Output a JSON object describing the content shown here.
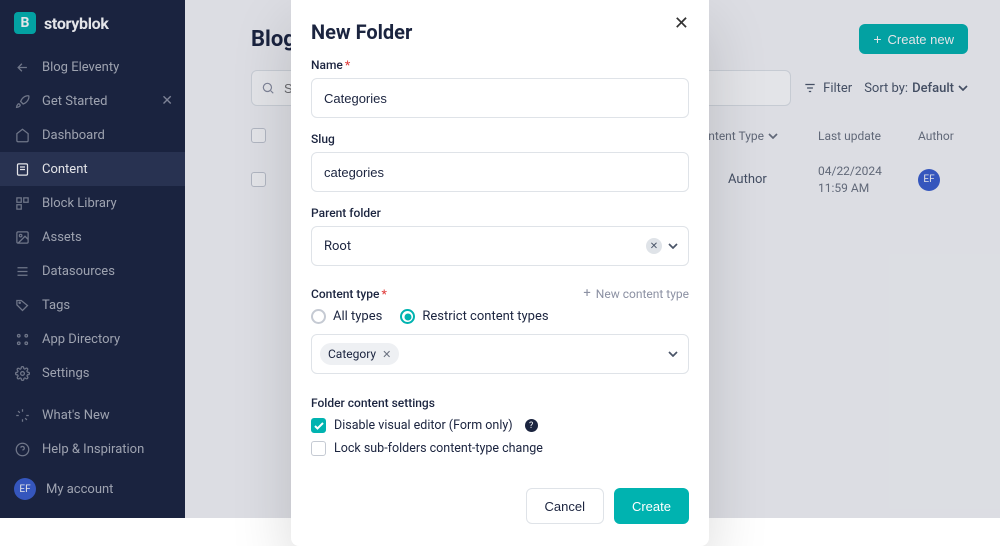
{
  "brand": "storyblok",
  "sidebar": {
    "space_name": "Blog Eleventy",
    "get_started": "Get Started",
    "items": [
      {
        "label": "Dashboard"
      },
      {
        "label": "Content"
      },
      {
        "label": "Block Library"
      },
      {
        "label": "Assets"
      },
      {
        "label": "Datasources"
      },
      {
        "label": "Tags"
      },
      {
        "label": "App Directory"
      },
      {
        "label": "Settings"
      }
    ],
    "footer": [
      {
        "label": "What's New"
      },
      {
        "label": "Help & Inspiration"
      }
    ],
    "account": {
      "initials": "EF",
      "label": "My account"
    }
  },
  "page": {
    "title": "Blog",
    "create_new": "Create new",
    "search_placeholder": "Search",
    "filter_label": "Filter",
    "sort_label": "Sort by:",
    "sort_value": "Default",
    "columns": {
      "content_type": "Content Type",
      "last_update": "Last update",
      "author": "Author"
    },
    "rows": [
      {
        "content_type": "Author",
        "last_update": "04/22/2024 11:59 AM",
        "author_initials": "EF"
      }
    ]
  },
  "modal": {
    "title": "New Folder",
    "labels": {
      "name": "Name",
      "slug": "Slug",
      "parent": "Parent folder",
      "content_type": "Content type",
      "new_content_type": "New content type",
      "folder_settings": "Folder content settings"
    },
    "values": {
      "name": "Categories",
      "slug": "categories",
      "parent": "Root",
      "chip": "Category"
    },
    "radios": {
      "all": "All types",
      "restrict": "Restrict content types"
    },
    "checks": {
      "disable_visual": "Disable visual editor (Form only)",
      "lock_sub": "Lock sub-folders content-type change"
    },
    "buttons": {
      "cancel": "Cancel",
      "create": "Create"
    }
  }
}
